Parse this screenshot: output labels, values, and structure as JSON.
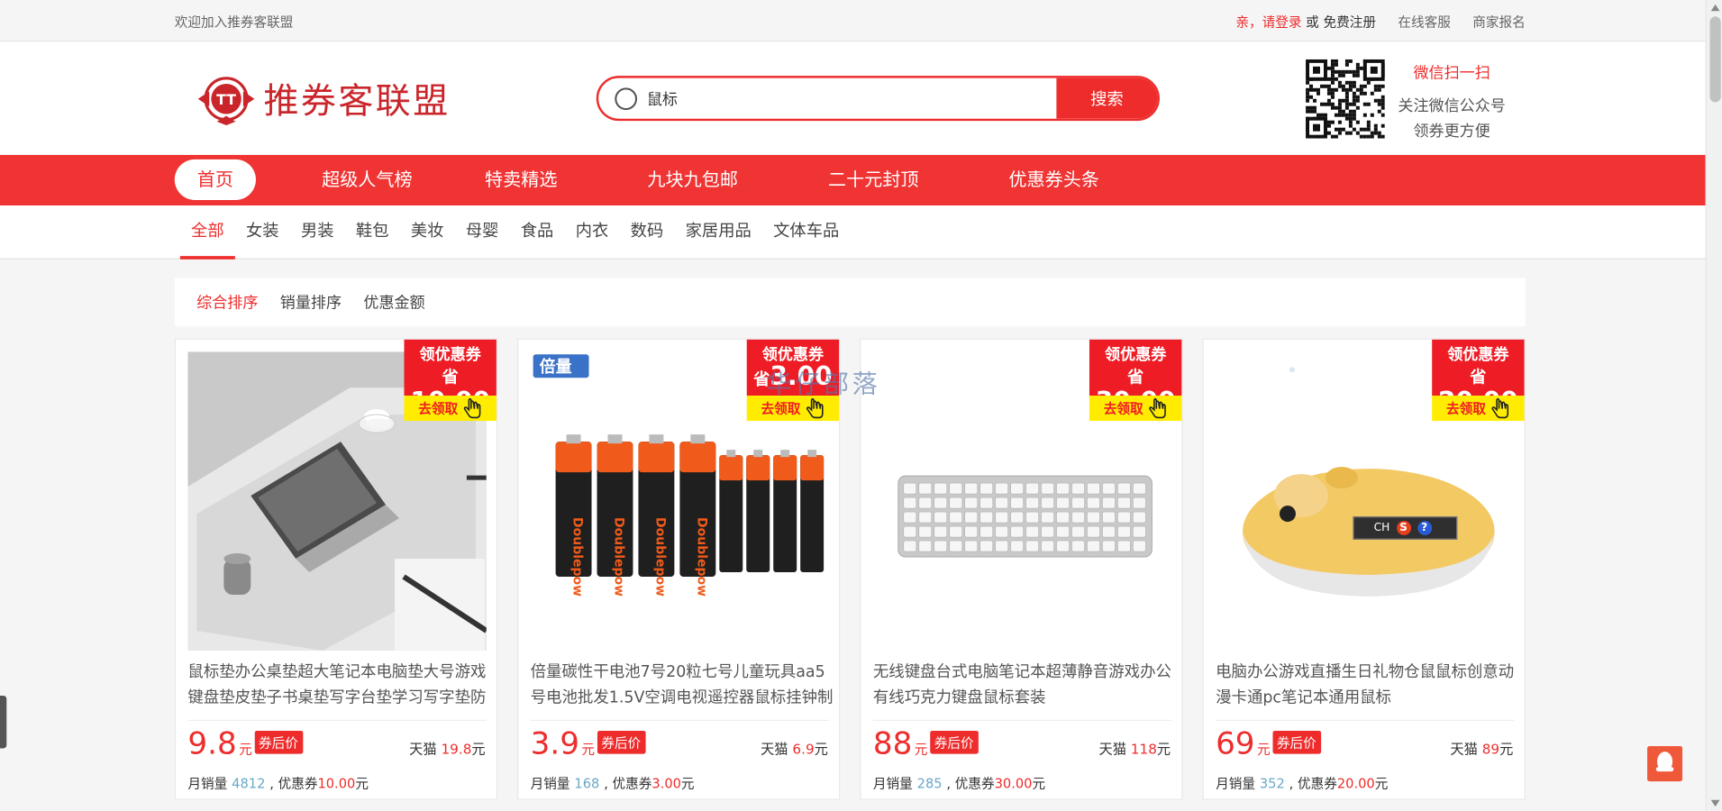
{
  "topbar": {
    "welcome": "欢迎加入推券客联盟",
    "login": "亲，请登录",
    "or": "或",
    "register": "免费注册",
    "service": "在线客服",
    "merchant": "商家报名"
  },
  "header": {
    "logo_text": "推券客联盟",
    "logo_mark": "TT",
    "search_value": "鼠标",
    "search_button": "搜索",
    "wechat_scan": "微信扫一扫",
    "wechat_follow": "关注微信公众号",
    "wechat_benefit": "领券更方便"
  },
  "nav": {
    "items": [
      "首页",
      "超级人气榜",
      "特卖精选",
      "九块九包邮",
      "二十元封顶",
      "优惠券头条"
    ]
  },
  "categories": [
    "全部",
    "女装",
    "男装",
    "鞋包",
    "美妆",
    "母婴",
    "食品",
    "内衣",
    "数码",
    "家居用品",
    "文体车品"
  ],
  "sort": [
    "综合排序",
    "销量排序",
    "优惠金额"
  ],
  "watermark": "华仔部落",
  "ime": {
    "text": "CH",
    "logo": "S",
    "help": "?"
  },
  "coupon_labels": {
    "get": "领优惠券",
    "save": "省",
    "go": "去领取"
  },
  "products": [
    {
      "title": "鼠标垫办公桌垫超大笔记本电脑垫大号游戏键盘垫皮垫子书桌垫写字台垫学习写字垫防",
      "coupon": "10.00",
      "price": "9.8",
      "yuan": "元",
      "after_label": "券后价",
      "orig_label": "天猫",
      "orig_price": "19.8",
      "orig_unit": "元",
      "sales_label": "月销量",
      "sales": "4812",
      "coupon_text": ", 优惠券",
      "coupon_value": "10.00",
      "coupon_unit": "元"
    },
    {
      "title": "倍量碳性干电池7号20粒七号儿童玩具aa5号电池批发1.5V空调电视遥控器鼠标挂钟制",
      "coupon": "3.00",
      "price": "3.9",
      "yuan": "元",
      "after_label": "券后价",
      "orig_label": "天猫",
      "orig_price": "6.9",
      "orig_unit": "元",
      "sales_label": "月销量",
      "sales": "168",
      "coupon_text": ", 优惠券",
      "coupon_value": "3.00",
      "coupon_unit": "元",
      "brand": "倍量"
    },
    {
      "title": "无线键盘台式电脑笔记本超薄静音游戏办公有线巧克力键盘鼠标套装",
      "coupon": "30.00",
      "price": "88",
      "yuan": "元",
      "after_label": "券后价",
      "orig_label": "天猫",
      "orig_price": "118",
      "orig_unit": "元",
      "sales_label": "月销量",
      "sales": "285",
      "coupon_text": ", 优惠券",
      "coupon_value": "30.00",
      "coupon_unit": "元"
    },
    {
      "title": "电脑办公游戏直播生日礼物仓鼠鼠标创意动漫卡通pc笔记本通用鼠标",
      "coupon": "20.00",
      "price": "69",
      "yuan": "元",
      "after_label": "券后价",
      "orig_label": "天猫",
      "orig_price": "89",
      "orig_unit": "元",
      "sales_label": "月销量",
      "sales": "352",
      "coupon_text": ", 优惠券",
      "coupon_value": "20.00",
      "coupon_unit": "元"
    }
  ],
  "colors": {
    "brand": "#ee2c2c",
    "nav": "#f03333",
    "coupon_bg": "#ee1c25",
    "coupon_yellow": "#ffec00",
    "sales_num": "#6aa8c8"
  }
}
